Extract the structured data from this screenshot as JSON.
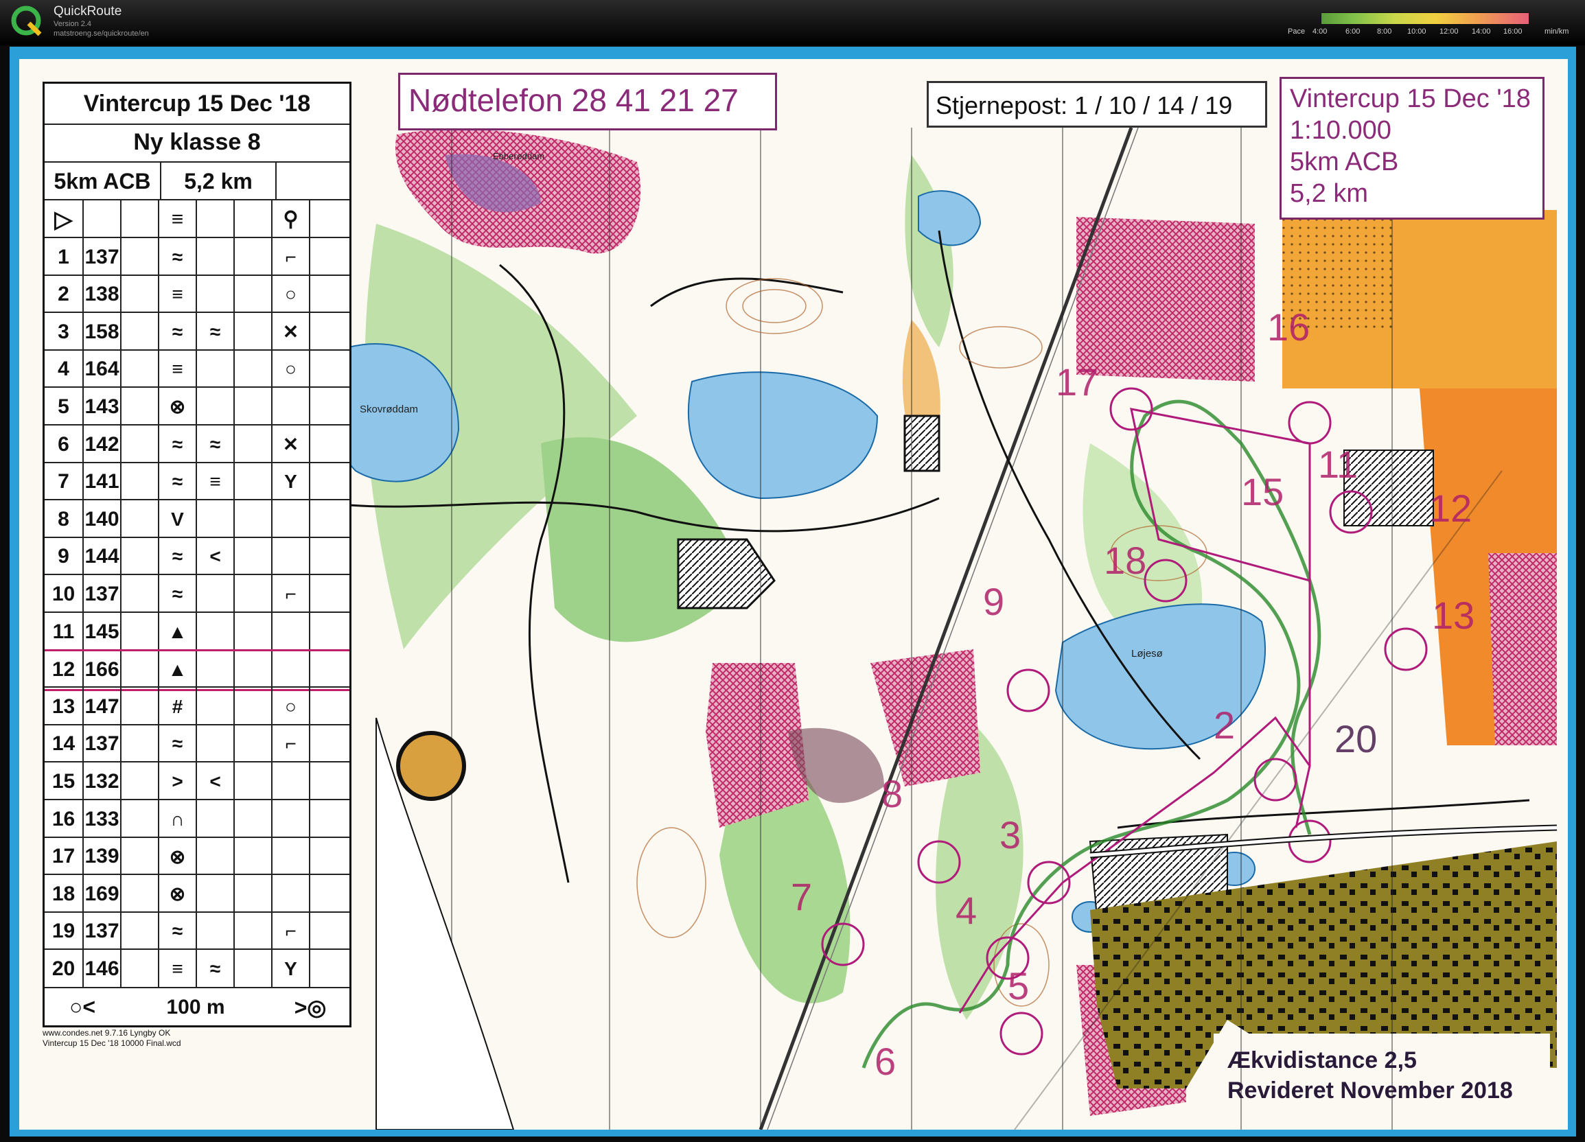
{
  "app": {
    "title": "QuickRoute",
    "version": "Version 2.4",
    "url": "matstroeng.se/quickroute/en",
    "pace_label": "Pace",
    "pace_ticks": [
      "4:00",
      "6:00",
      "8:00",
      "10:00",
      "12:00",
      "14:00",
      "16:00"
    ],
    "pace_unit": "min/km"
  },
  "map": {
    "emergency": "Nødtelefon 28 41 21 27",
    "star_controls": "Stjernepost: 1 / 10 / 14 / 19",
    "info": [
      "Vintercup 15 Dec '18",
      "1:10.000",
      "5km ACB",
      "5,2 km"
    ],
    "contour_interval": "Ækvidistance 2,5",
    "revised": "Revideret November 2018",
    "places": [
      "Skovrøddam",
      "Løjesø",
      "Ebberøddam"
    ],
    "control_numbers": [
      "16",
      "17",
      "11",
      "12",
      "15",
      "18",
      "13",
      "9",
      "2",
      "20",
      "8",
      "3",
      "7",
      "4",
      "5",
      "6"
    ]
  },
  "description": {
    "title": "Vintercup 15 Dec '18",
    "class": "Ny klasse 8",
    "course": "5km ACB",
    "length": "5,2 km",
    "finish": "100 m",
    "rows": [
      {
        "n": "1",
        "code": "137"
      },
      {
        "n": "2",
        "code": "138"
      },
      {
        "n": "3",
        "code": "158"
      },
      {
        "n": "4",
        "code": "164"
      },
      {
        "n": "5",
        "code": "143"
      },
      {
        "n": "6",
        "code": "142"
      },
      {
        "n": "7",
        "code": "141"
      },
      {
        "n": "8",
        "code": "140"
      },
      {
        "n": "9",
        "code": "144"
      },
      {
        "n": "10",
        "code": "137"
      },
      {
        "n": "11",
        "code": "145"
      },
      {
        "n": "12",
        "code": "166"
      },
      {
        "n": "13",
        "code": "147"
      },
      {
        "n": "14",
        "code": "137"
      },
      {
        "n": "15",
        "code": "132"
      },
      {
        "n": "16",
        "code": "133"
      },
      {
        "n": "17",
        "code": "139"
      },
      {
        "n": "18",
        "code": "169"
      },
      {
        "n": "19",
        "code": "137"
      },
      {
        "n": "20",
        "code": "146"
      }
    ],
    "symbols": {
      "1": [
        "≈",
        "",
        "⌐"
      ],
      "2": [
        "≡",
        "",
        "○"
      ],
      "3": [
        "≈",
        "≈",
        "✕"
      ],
      "4": [
        "≡",
        "",
        "○"
      ],
      "5": [
        "⊗",
        "",
        ""
      ],
      "6": [
        "≈",
        "≈",
        "✕"
      ],
      "7": [
        "≈",
        "≡",
        "Y"
      ],
      "8": [
        "V",
        "",
        ""
      ],
      "9": [
        "≈",
        "<",
        ""
      ],
      "10": [
        "≈",
        "",
        "⌐"
      ],
      "11": [
        "▲",
        "",
        ""
      ],
      "12": [
        "▲",
        "",
        ""
      ],
      "13": [
        "#",
        "",
        "○"
      ],
      "14": [
        "≈",
        "",
        "⌐"
      ],
      "15": [
        ">",
        "<",
        ""
      ],
      "16": [
        "∩",
        "",
        ""
      ],
      "17": [
        "⊗",
        "",
        ""
      ],
      "18": [
        "⊗",
        "",
        ""
      ],
      "19": [
        "≈",
        "",
        "⌐"
      ],
      "20": [
        "≡",
        "≈",
        "Y"
      ]
    },
    "footer": [
      "www.condes.net 9.7.16 Lyngby OK",
      "Vintercup 15 Dec '18 10000 Final.wcd"
    ]
  }
}
